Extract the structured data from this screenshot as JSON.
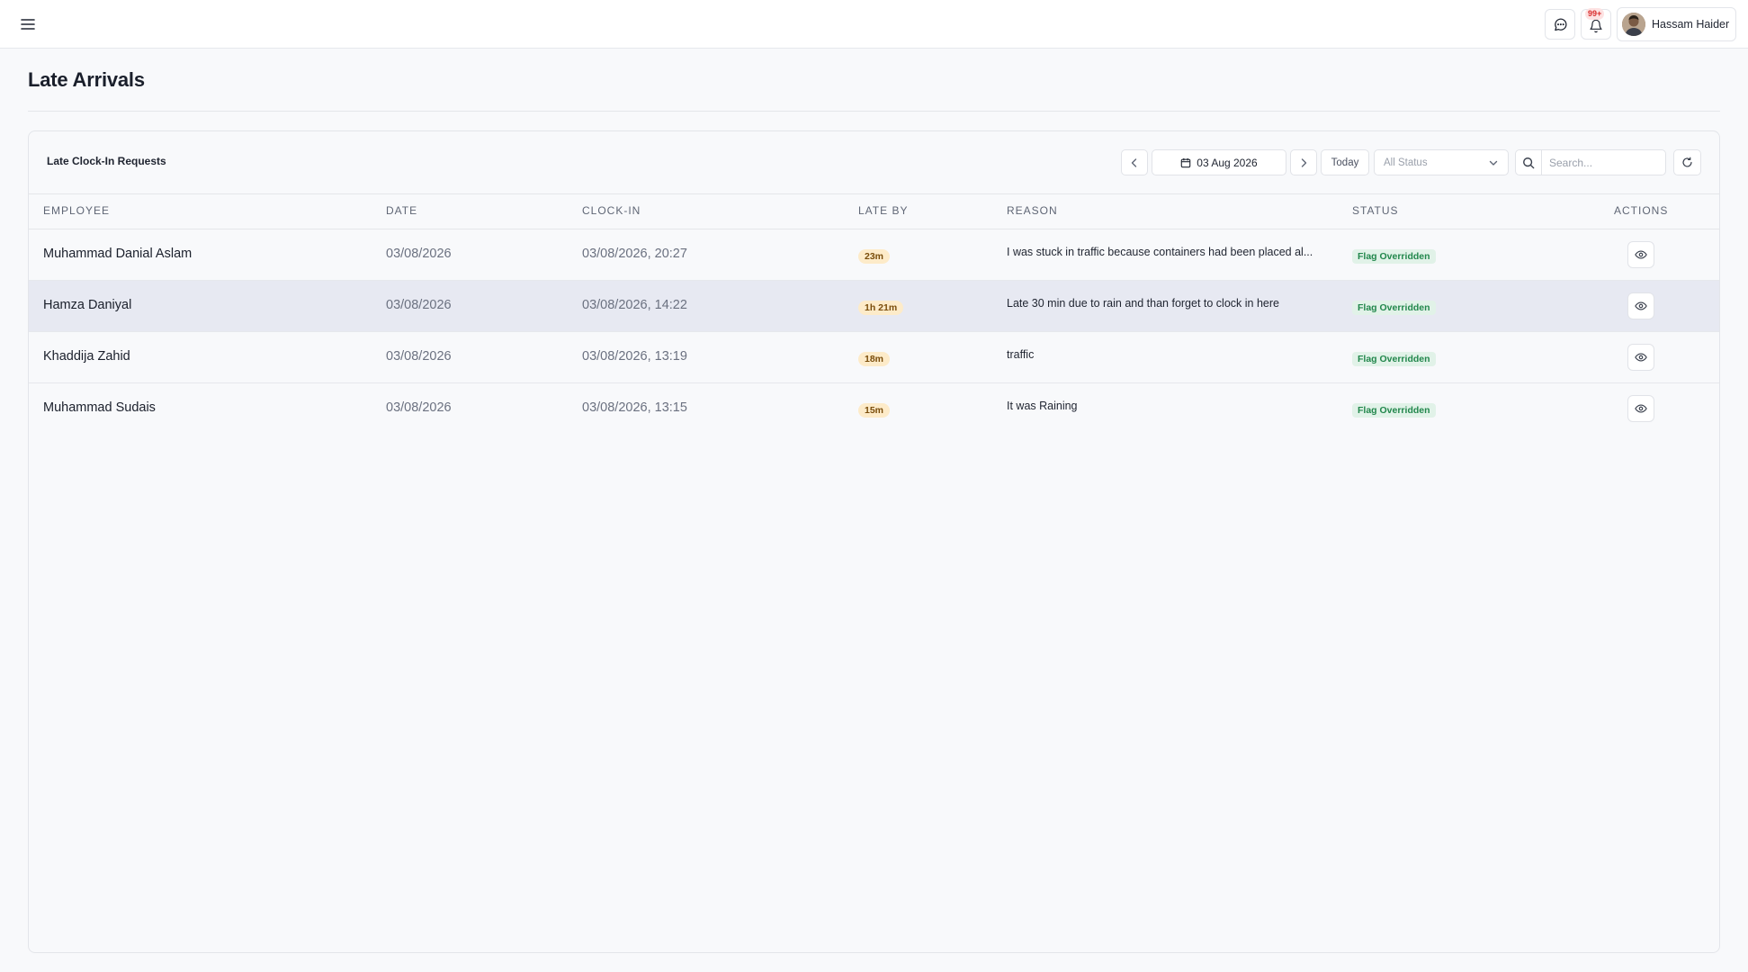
{
  "header": {
    "user_name": "Hassam Haider",
    "notification_count": "99+"
  },
  "page": {
    "title": "Late Arrivals"
  },
  "card": {
    "title": "Late Clock-In Requests",
    "date_value": "03 Aug 2026",
    "today_label": "Today",
    "status_selected": "All Status",
    "search_placeholder": "Search..."
  },
  "table": {
    "columns": [
      "EMPLOYEE",
      "DATE",
      "CLOCK-IN",
      "LATE BY",
      "REASON",
      "STATUS",
      "ACTIONS"
    ],
    "rows": [
      {
        "employee": "Muhammad Danial Aslam",
        "date": "03/08/2026",
        "clock_in": "03/08/2026, 20:27",
        "late_by": "23m",
        "reason": "I was stuck in traffic because containers had been placed al...",
        "status": "Flag Overridden"
      },
      {
        "employee": "Hamza Daniyal",
        "date": "03/08/2026",
        "clock_in": "03/08/2026, 14:22",
        "late_by": "1h 21m",
        "reason": "Late 30 min due to rain and than forget to clock in here",
        "status": "Flag Overridden"
      },
      {
        "employee": "Khaddija Zahid",
        "date": "03/08/2026",
        "clock_in": "03/08/2026, 13:19",
        "late_by": "18m",
        "reason": "traffic",
        "status": "Flag Overridden"
      },
      {
        "employee": "Muhammad Sudais",
        "date": "03/08/2026",
        "clock_in": "03/08/2026, 13:15",
        "late_by": "15m",
        "reason": "It was Raining",
        "status": "Flag Overridden"
      }
    ]
  },
  "icons": {
    "menu": "hamburger-menu-icon",
    "chat": "chat-bubble-icon",
    "bell": "bell-icon",
    "calendar": "calendar-icon",
    "search": "search-icon",
    "refresh": "refresh-icon",
    "view": "eye-icon"
  },
  "colors": {
    "late_badge_bg": "#fdebc9",
    "status_badge_bg": "#e1f2e8",
    "status_badge_text": "#22874c",
    "highlight_row": "#e7e9f2"
  }
}
